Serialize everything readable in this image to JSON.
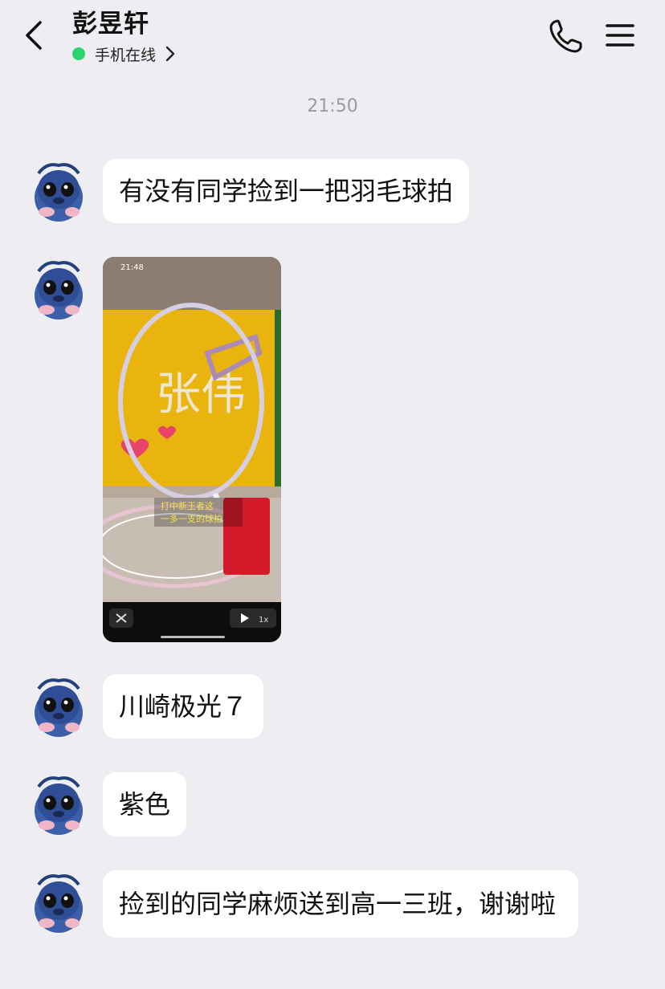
{
  "header": {
    "contact_name": "彭昱轩",
    "status_text": "手机在线",
    "back_icon": "chevron-left-icon",
    "call_icon": "phone-icon",
    "menu_icon": "hamburger-menu-icon",
    "online_color": "#2bd46f"
  },
  "chat": {
    "timestamp": "21:50",
    "messages": [
      {
        "type": "text",
        "text": "有没有同学捡到一把羽毛球拍"
      },
      {
        "type": "video",
        "overlay_time": "21:48",
        "board_text": "张伟",
        "caption_line1": "打中新王者这",
        "caption_line2": "一多一支的球拍",
        "speed": "1x"
      },
      {
        "type": "text",
        "text": "川崎极光７"
      },
      {
        "type": "text",
        "text": "紫色"
      },
      {
        "type": "text",
        "text": "捡到的同学麻烦送到高一三班，谢谢啦"
      }
    ]
  }
}
